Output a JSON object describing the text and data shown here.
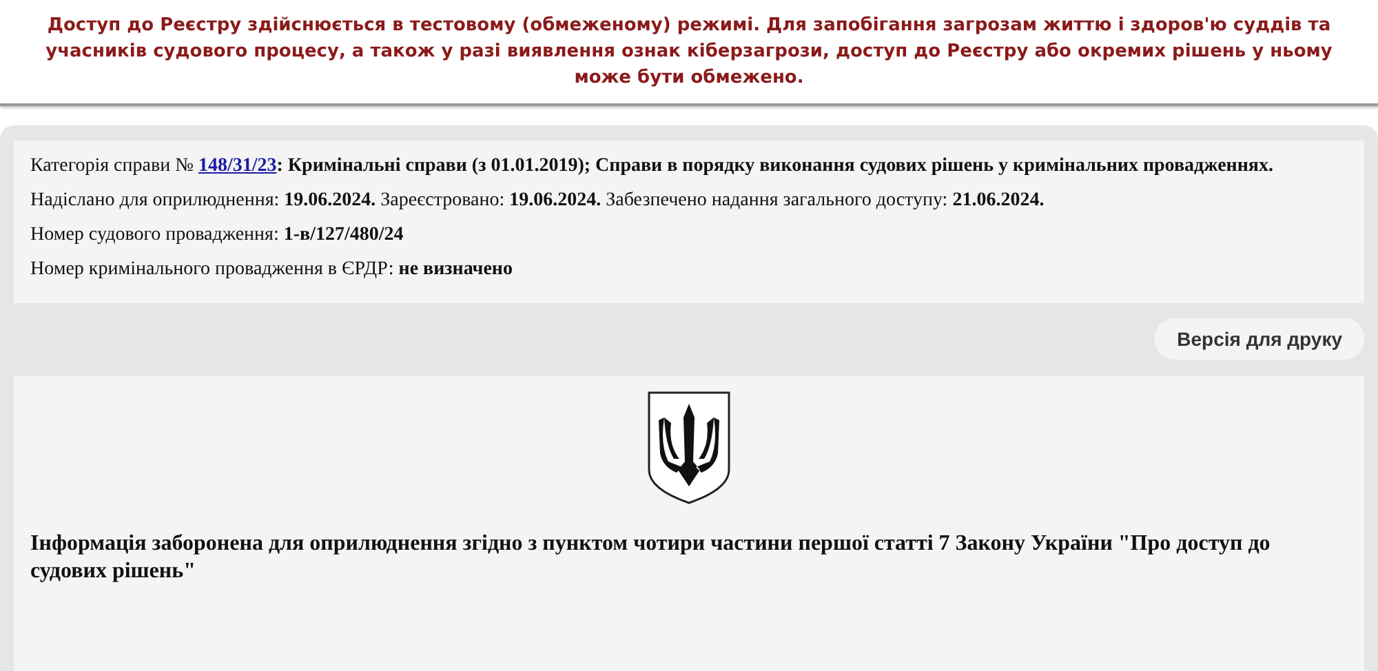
{
  "notice": "Доступ до Реєстру здійснюється в тестовому (обмеженому) режимі. Для запобігання загрозам життю і здоров'ю суддів та учасників судового процесу, а також у разі виявлення ознак кіберзагрози, доступ до Реєстру або окремих рішень у ньому може бути обмежено.",
  "case_info": {
    "category_prefix": "Категорія справи №",
    "case_link": "148/31/23",
    "category_rest": "**: Кримінальні справи (з 01.01.2019); Справи в порядку виконання судових рішень у кримінальних провадженнях.**",
    "lines": [
      "Надіслано для оприлюднення: **19.06.2024.** Зареєстровано: **19.06.2024.** Забезпечено надання загального доступу: **21.06.2024.**",
      "Номер судового провадження: **1-в/127/480/24**",
      "Номер кримінального провадження в ЄРДР: **не визначено**"
    ]
  },
  "print_button": "Версія для друку",
  "document": {
    "message": "Інформація заборонена для оприлюднення згідно з пунктом чотири частини першої статті 7 Закону України \"Про доступ до судових рішень\""
  }
}
